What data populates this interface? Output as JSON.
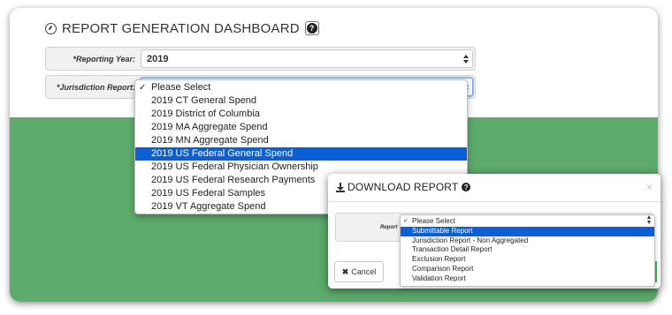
{
  "dashboard": {
    "title": "REPORT GENERATION DASHBOARD",
    "icon": "gauge-icon",
    "help_glyph": "?",
    "reporting_year": {
      "label": "*Reporting Year:",
      "value": "2019"
    },
    "jurisdiction_report": {
      "label": "*Jurisdiction Report:",
      "options": [
        "Please Select",
        "2019 CT General Spend",
        "2019 District of Columbia",
        "2019 MA Aggregate Spend",
        "2019 MN Aggregate Spend",
        "2019 US Federal General Spend",
        "2019 US Federal Physician Ownership",
        "2019 US Federal Research Payments",
        "2019 US Federal Samples",
        "2019 VT Aggregate Spend"
      ],
      "checked_index": 0,
      "highlighted_index": 5,
      "check_glyph": "✓"
    }
  },
  "download_modal": {
    "title": "DOWNLOAD REPORT",
    "help_glyph": "?",
    "close_glyph": "×",
    "report_label": "Report",
    "report_options": [
      "Please Select",
      "Submittable Report",
      "Jurisdiction Report - Non Aggregated",
      "Transaction Detail Report",
      "Exclusion Report",
      "Comparison Report",
      "Validation Report"
    ],
    "checked_index": 0,
    "highlighted_index": 1,
    "check_glyph": "✓",
    "cancel_label": "Cancel",
    "cancel_glyph": "✖"
  },
  "colors": {
    "accent_green": "#5cab6c",
    "button_green": "#4cae5c",
    "selection_blue": "#0a5fd6"
  }
}
